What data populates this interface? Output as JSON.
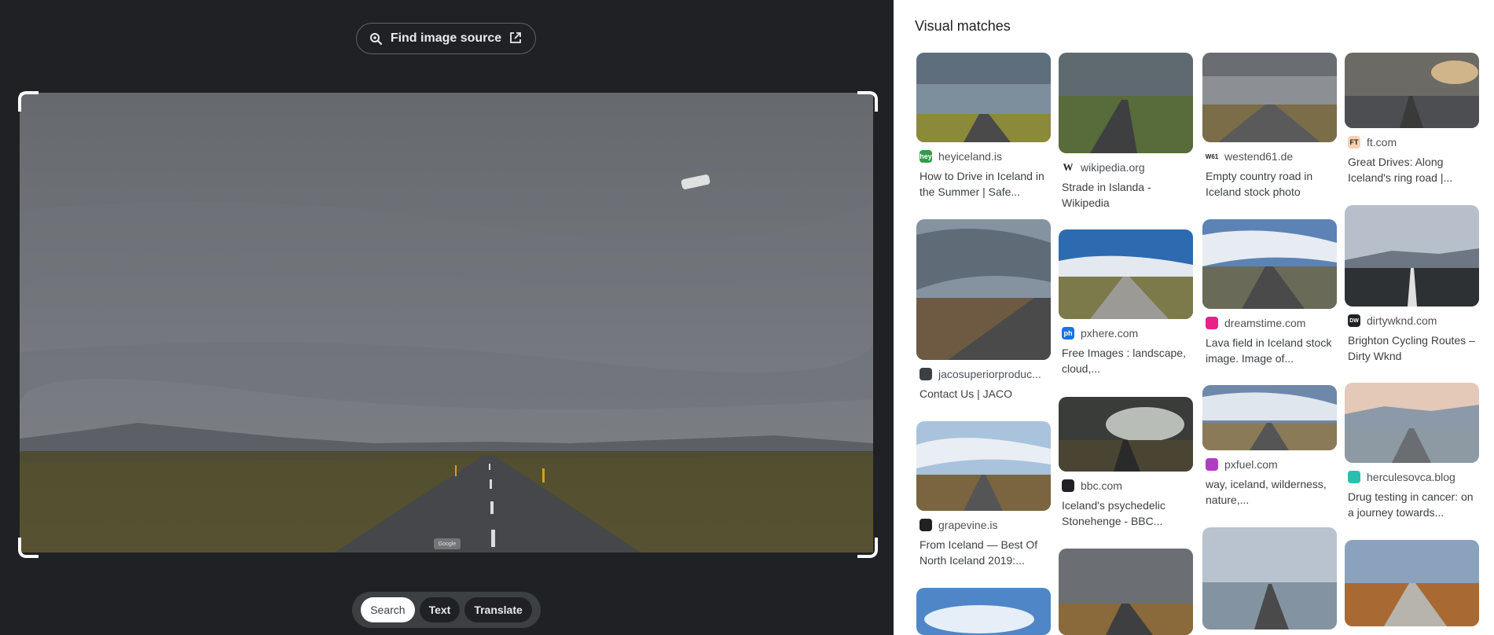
{
  "find_source": {
    "label": "Find image source"
  },
  "photo": {
    "watermark": "Google"
  },
  "modes": [
    {
      "label": "Search",
      "active": true
    },
    {
      "label": "Text",
      "active": false
    },
    {
      "label": "Translate",
      "active": false
    }
  ],
  "panel": {
    "title": "Visual matches"
  },
  "matches": [
    {
      "site": "heyiceland.is",
      "caption": "How to Drive in Iceland in the Summer | Safe...",
      "favicon": "hey",
      "favicon_color": "#2e9c48"
    },
    {
      "site": "wikipedia.org",
      "caption": "Strade in Islanda - Wikipedia",
      "favicon": "W",
      "favicon_color": "#ffffff"
    },
    {
      "site": "westend61.de",
      "caption": "Empty country road in Iceland stock photo",
      "favicon": "W61",
      "favicon_color": "#ffffff"
    },
    {
      "site": "ft.com",
      "caption": "Great Drives: Along Iceland's ring road |...",
      "favicon": "FT",
      "favicon_color": "#fcd0b1"
    },
    {
      "site": "jacosuperiorproduc...",
      "caption": "Contact Us | JACO",
      "favicon": "",
      "favicon_color": "#3c4043"
    },
    {
      "site": "pxhere.com",
      "caption": "Free Images : landscape, cloud,...",
      "favicon": "ph",
      "favicon_color": "#1a73e8"
    },
    {
      "site": "dreamstime.com",
      "caption": "Lava field in Iceland stock image. Image of...",
      "favicon": "",
      "favicon_color": "#e8228a"
    },
    {
      "site": "dirtywknd.com",
      "caption": "Brighton Cycling Routes – Dirty Wknd",
      "favicon": "DW",
      "favicon_color": "#202124"
    },
    {
      "site": "grapevine.is",
      "caption": "From Iceland — Best Of North Iceland 2019:...",
      "favicon": "",
      "favicon_color": "#202124"
    },
    {
      "site": "bbc.com",
      "caption": "Iceland's psychedelic Stonehenge - BBC...",
      "favicon": "",
      "favicon_color": "#202124"
    },
    {
      "site": "pxfuel.com",
      "caption": "way, iceland, wilderness, nature,...",
      "favicon": "",
      "favicon_color": "#b03cc2"
    },
    {
      "site": "herculesovca.blog",
      "caption": "Drug testing in cancer: on a journey towards...",
      "favicon": "",
      "favicon_color": "#2bbfb0"
    }
  ]
}
